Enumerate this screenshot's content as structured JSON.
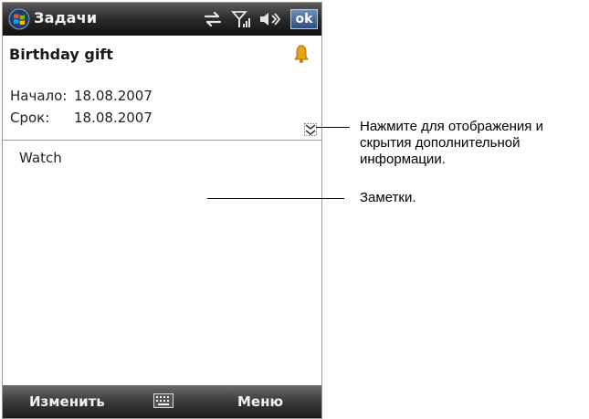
{
  "titlebar": {
    "app_title": "Задачи",
    "ok_label": "ok",
    "icons": [
      "windows-start-icon",
      "sync-icon",
      "signal-icon",
      "volume-icon"
    ]
  },
  "task": {
    "title": "Birthday gift",
    "reminder_icon": "bell-icon",
    "start_label": "Начало:",
    "start_value": "18.08.2007",
    "due_label": "Срок:",
    "due_value": "18.08.2007",
    "notes": "Watch"
  },
  "softkeys": {
    "left": "Изменить",
    "right": "Меню",
    "center_icon": "keyboard-icon"
  },
  "callouts": {
    "toggle_line1": "Нажмите для отображения и",
    "toggle_line2": "скрытия дополнительной",
    "toggle_line3": "информации.",
    "notes": "Заметки."
  },
  "colors": {
    "bar_dark": "#2a2a2a",
    "ok_blue": "#3d5f8d",
    "bell": "#e8a21a"
  }
}
